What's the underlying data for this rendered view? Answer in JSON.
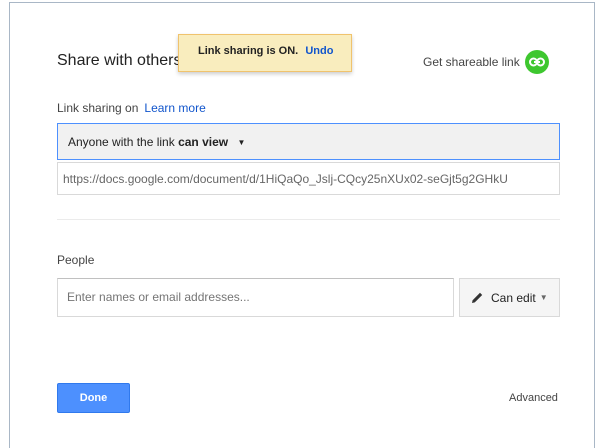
{
  "dialog": {
    "title": "Share with others"
  },
  "toast": {
    "message": "Link sharing is ON.",
    "undo_label": "Undo"
  },
  "shareable_link": {
    "label": "Get shareable link",
    "icon": "link-icon",
    "icon_color": "#3ec72f"
  },
  "link_sharing": {
    "status": "Link sharing on",
    "learn_more": "Learn more",
    "access_prefix": "Anyone with the link",
    "access_level": "can view",
    "url": "https://docs.google.com/document/d/1HiQaQo_Jslj-CQcy25nXUx02-seGjt5g2GHkU"
  },
  "people": {
    "label": "People",
    "input_placeholder": "Enter names or email addresses...",
    "permission_label": "Can edit",
    "permission_icon": "pencil-icon"
  },
  "footer": {
    "done_label": "Done",
    "advanced_label": "Advanced",
    "done_color": "#4d90fe"
  }
}
